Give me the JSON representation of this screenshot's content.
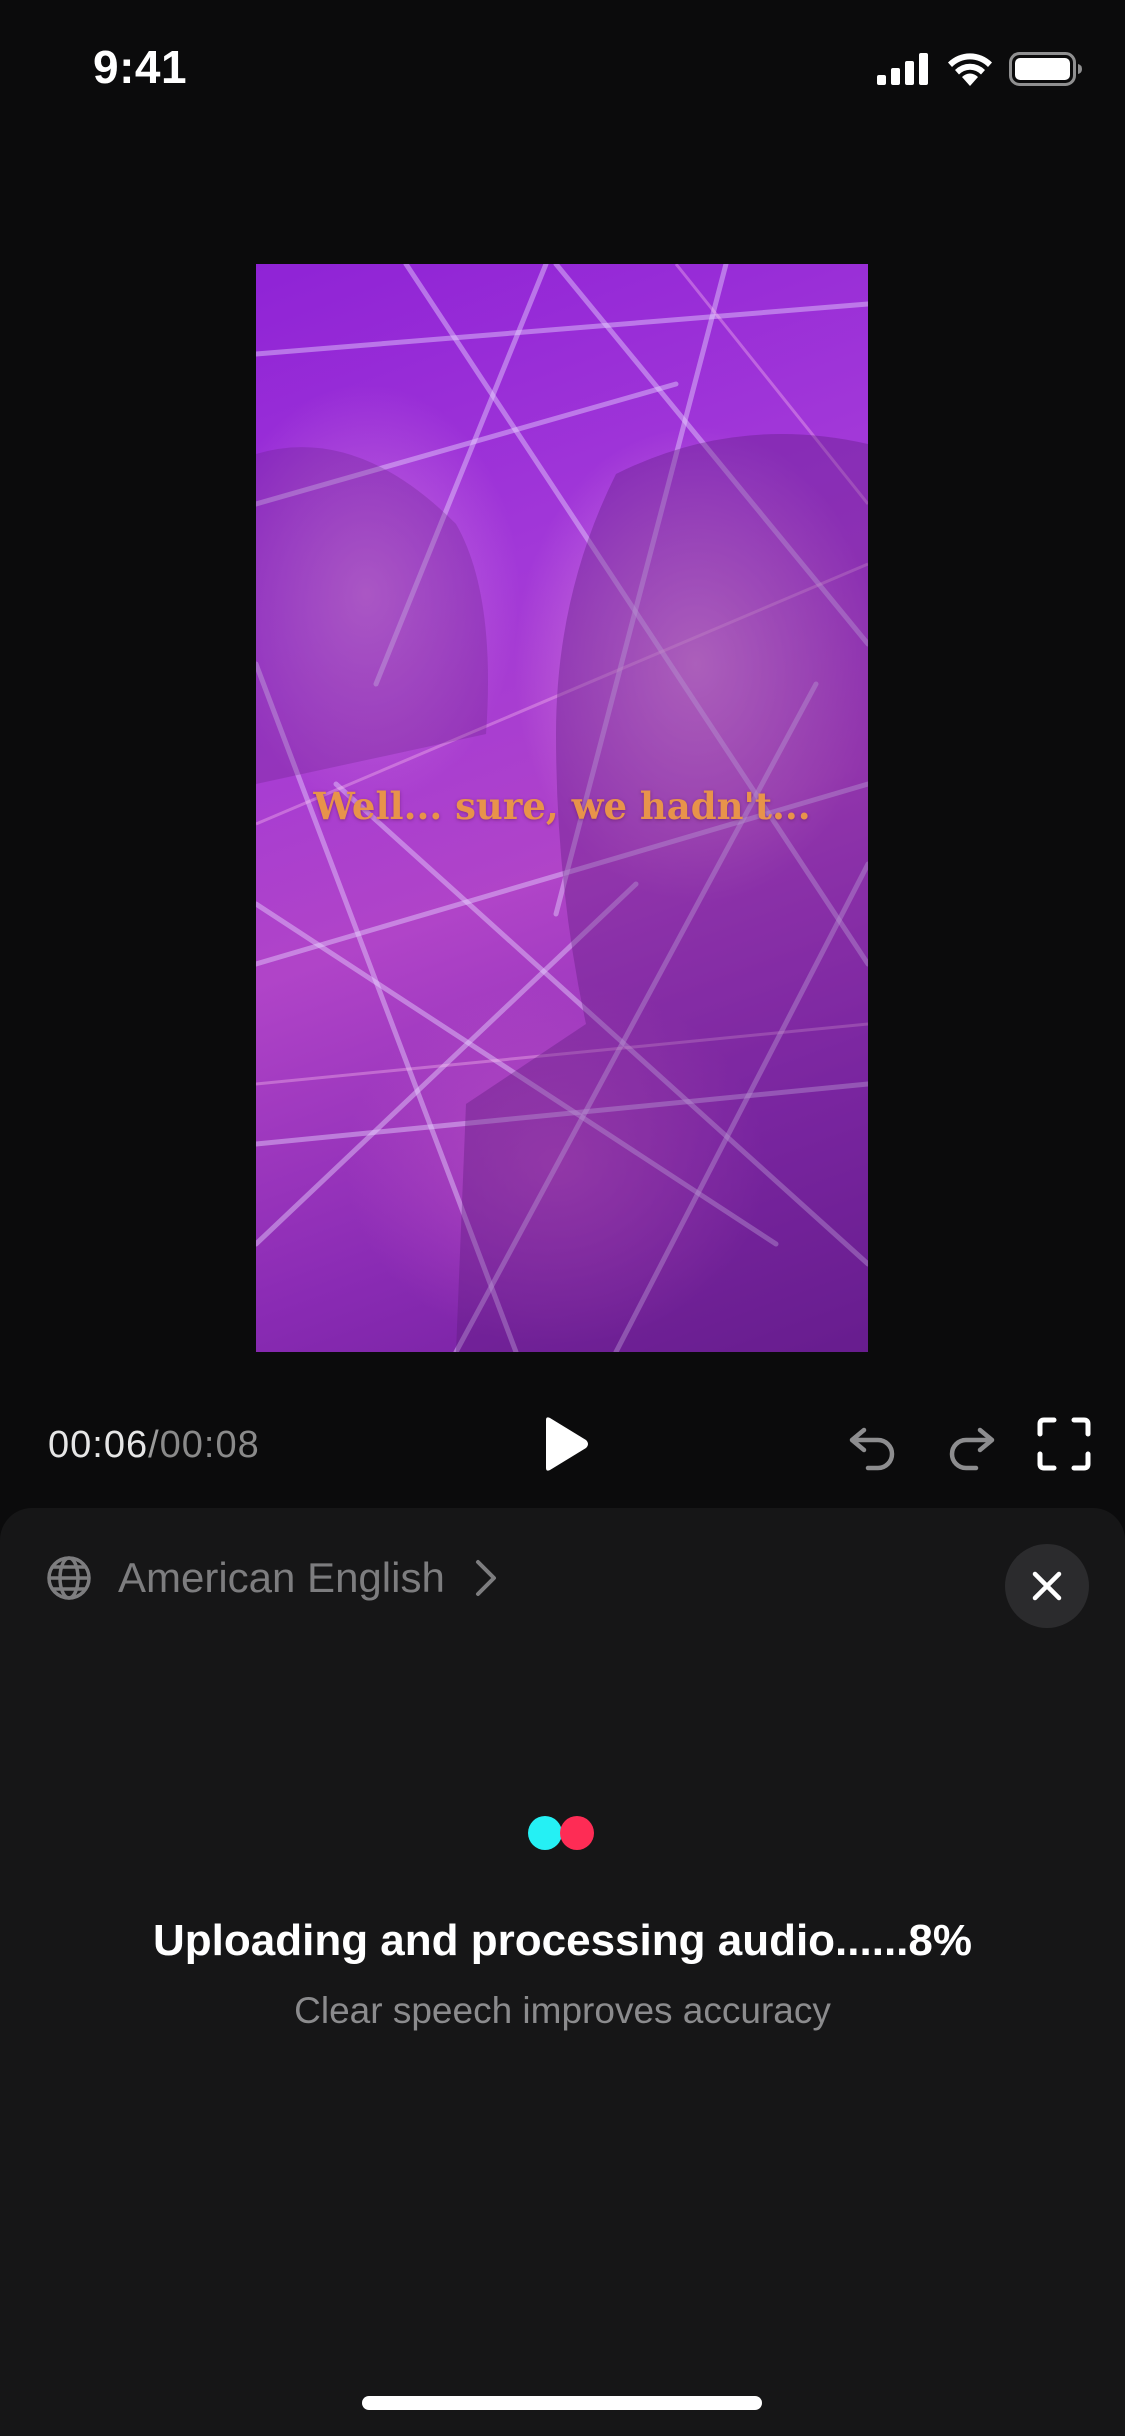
{
  "status_bar": {
    "time": "9:41",
    "icons": [
      "cellular-signal-icon",
      "wifi-icon",
      "battery-icon"
    ]
  },
  "video": {
    "caption": "Well... sure, we hadn't...",
    "caption_color": "#e8934a"
  },
  "playback": {
    "current_time": "00:06",
    "separator": "/",
    "total_time": "00:08",
    "controls": [
      "play-icon",
      "undo-icon",
      "redo-icon",
      "fullscreen-icon"
    ]
  },
  "panel": {
    "language": "American English",
    "language_icon": "globe-icon",
    "close_icon": "close-icon",
    "progress_text": "Uploading and processing audio......8%",
    "progress_percent": 8,
    "hint": "Clear speech improves accuracy",
    "loader_colors": [
      "#25f0f4",
      "#fe2c55"
    ]
  },
  "colors": {
    "background": "#0b0b0c",
    "panel": "#161617"
  }
}
